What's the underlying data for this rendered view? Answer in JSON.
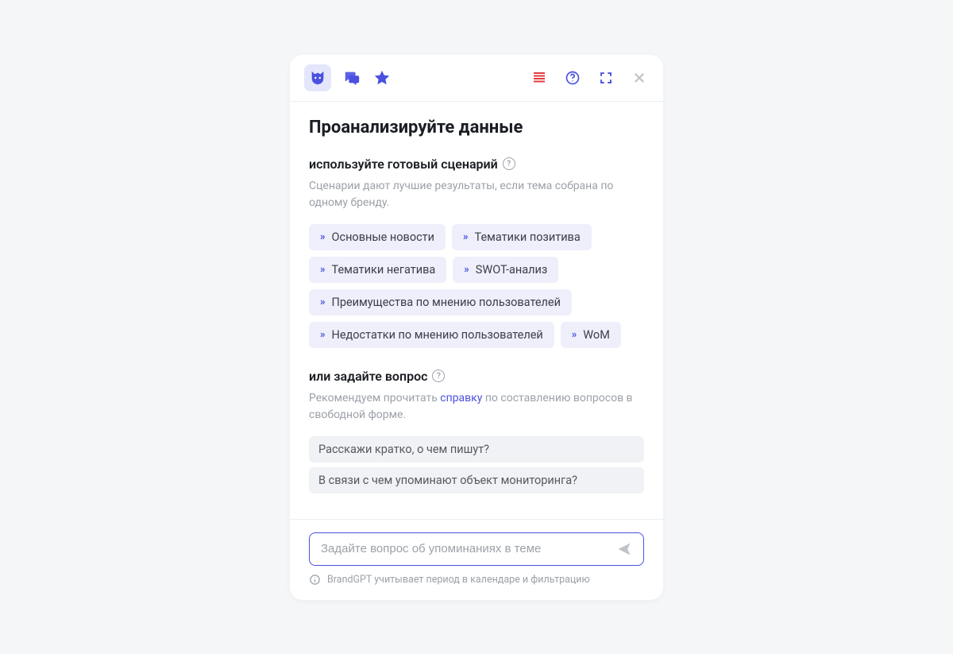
{
  "title": "Проанализируйте данные",
  "section_scenario": {
    "heading": "используйте готовый сценарий",
    "description": "Сценарии дают лучшие результаты, если тема собрана по одному бренду.",
    "chips": [
      "Основные новости",
      "Тематики позитива",
      "Тематики негатива",
      "SWOT-анализ",
      "Преимущества по мнению пользователей",
      "Недостатки по мнению пользователей",
      "WoM"
    ]
  },
  "section_question": {
    "heading": "или задайте вопрос",
    "desc_prefix": "Рекомендуем прочитать ",
    "desc_link": "справку",
    "desc_suffix": " по составлению вопросов в свободной форме.",
    "examples": [
      "Расскажи кратко, о чем пишут?",
      "В связи с чем упоминают объект мониторинга?"
    ]
  },
  "input": {
    "placeholder": "Задайте вопрос об упоминаниях в теме"
  },
  "footnote": "BrandGPT учитывает период в календаре и фильтрацию",
  "colors": {
    "accent": "#4a50e0",
    "chip_bg": "#eeeffb",
    "danger": "#e23a3f"
  }
}
